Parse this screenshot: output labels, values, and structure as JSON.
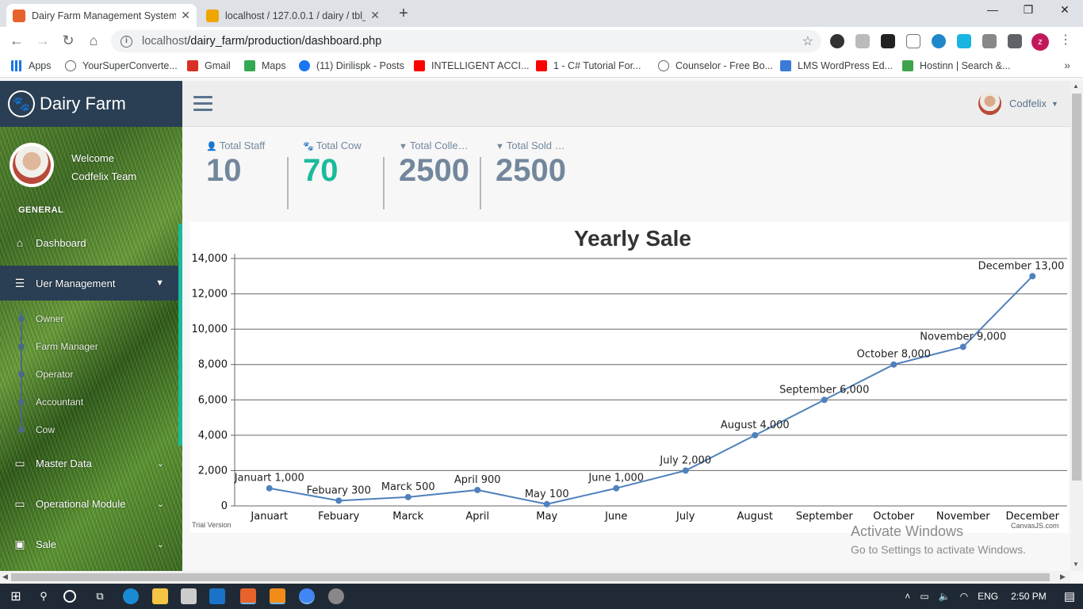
{
  "browser": {
    "tabs": [
      {
        "title": "Dairy Farm Management System",
        "active": true,
        "favicon_color": "#e8622c"
      },
      {
        "title": "localhost / 127.0.0.1 / dairy / tbl_",
        "active": false,
        "favicon_color": "#f0a500"
      }
    ],
    "url_host": "localhost",
    "url_path": "/dairy_farm/production/dashboard.php",
    "profile_initial": "z",
    "bookmarks": [
      {
        "label": "Apps",
        "icon": "apps-grid-icon",
        "color": "#1a73e8"
      },
      {
        "label": "YourSuperConverte...",
        "icon": "search-icon",
        "color": "#5f6368"
      },
      {
        "label": "Gmail",
        "icon": "gmail-icon",
        "color": "#d93025"
      },
      {
        "label": "Maps",
        "icon": "maps-icon",
        "color": "#34a853"
      },
      {
        "label": "(11) Dirilispk - Posts",
        "icon": "facebook-icon",
        "color": "#1877f2"
      },
      {
        "label": "INTELLIGENT ACCI...",
        "icon": "youtube-icon",
        "color": "#ff0000"
      },
      {
        "label": "1 - C# Tutorial For...",
        "icon": "youtube-icon",
        "color": "#ff0000"
      },
      {
        "label": "Counselor - Free Bo...",
        "icon": "wordpress-icon",
        "color": "#666666"
      },
      {
        "label": "LMS WordPress Ed...",
        "icon": "m-icon",
        "color": "#3a7bd5"
      },
      {
        "label": "Hostinn | Search &...",
        "icon": "h-icon",
        "color": "#3fa34d"
      }
    ]
  },
  "app": {
    "brand": "Dairy Farm",
    "welcome": "Welcome",
    "team": "Codfelix Team",
    "section_title": "GENERAL",
    "menu": [
      {
        "label": "Dashboard",
        "icon": "home-icon"
      },
      {
        "label": "Uer Management",
        "icon": "list-icon"
      },
      {
        "label": "Master Data",
        "icon": "desktop-icon"
      },
      {
        "label": "Operational Module",
        "icon": "desktop-icon"
      },
      {
        "label": "Sale",
        "icon": "money-icon"
      }
    ],
    "submenu": [
      "Owner",
      "Farm Manager",
      "Operator",
      "Accountant",
      "Cow"
    ],
    "user": "Codfelix"
  },
  "tiles": [
    {
      "label": "Total Staff",
      "value": "10",
      "icon": "user-icon",
      "color": "#73879c"
    },
    {
      "label": "Total Cow",
      "value": "70",
      "icon": "paw-icon",
      "color": "#1abb9c"
    },
    {
      "label": "Total Collection",
      "value": "2500",
      "icon": "filter-icon",
      "color": "#73879c"
    },
    {
      "label": "Total Sold Milk",
      "value": "2500",
      "icon": "filter-icon",
      "color": "#73879c"
    }
  ],
  "chart_data": {
    "type": "line",
    "title": "Yearly Sale",
    "categories": [
      "Januart",
      "Febuary",
      "Marck",
      "April",
      "May",
      "June",
      "July",
      "August",
      "September",
      "October",
      "November",
      "December"
    ],
    "values": [
      1000,
      300,
      500,
      900,
      100,
      1000,
      2000,
      4000,
      6000,
      8000,
      9000,
      13000
    ],
    "data_labels": [
      "Januart 1,000",
      "Febuary 300",
      "Marck 500",
      "April 900",
      "May 100",
      "June 1,000",
      "July 2,000",
      "August 4,000",
      "September 6,000",
      "October 8,000",
      "November 9,000",
      "December 13,00"
    ],
    "ylim": [
      0,
      14000
    ],
    "yticks": [
      0,
      2000,
      4000,
      6000,
      8000,
      10000,
      12000,
      14000
    ],
    "ytick_labels": [
      "0",
      "2,000",
      "4,000",
      "6,000",
      "8,000",
      "10,000",
      "12,000",
      "14,000"
    ],
    "grid": true,
    "line_color": "#4f81bc",
    "footer_left": "Trial Version",
    "footer_right": "CanvasJS.com"
  },
  "overlay": {
    "activate_title": "Activate Windows",
    "activate_sub": "Go to Settings to activate Windows."
  },
  "taskbar": {
    "lang": "ENG",
    "time": "2:50 PM"
  }
}
